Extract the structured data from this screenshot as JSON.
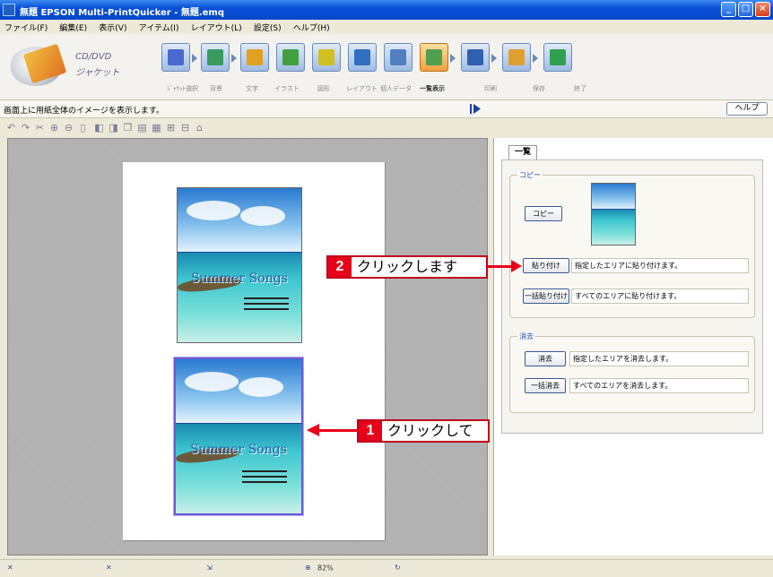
{
  "window": {
    "title": "無題 EPSON Multi-PrintQuicker - 無題.emq"
  },
  "menu": [
    "ファイル(F)",
    "編集(E)",
    "表示(V)",
    "アイテム(I)",
    "レイアウト(L)",
    "設定(S)",
    "ヘルプ(H)"
  ],
  "brand": {
    "line1": "CD/DVD",
    "line2": "ジャケット"
  },
  "toolbar": {
    "labels": [
      "ｼﾞｬｹｯﾄ選択",
      "背景",
      "文字",
      "イラスト",
      "図形",
      "レイアウト",
      "個人データ",
      "一覧表示",
      "印刷",
      "保存",
      "終了"
    ],
    "colors": {
      "tool_bg": "#9fbce4",
      "active_bg": "#f0a040"
    }
  },
  "infobar": {
    "message": "画面上に用紙全体のイメージを表示します。",
    "help_label": "ヘルプ"
  },
  "panel": {
    "tab_label": "一覧",
    "copy_group_title": "コピー",
    "copy_button": "コピー",
    "paste_button": "貼り付け",
    "paste_desc": "指定したエリアに貼り付けます。",
    "paste_all_button": "一括貼り付け",
    "paste_all_desc": "すべてのエリアに貼り付けます。",
    "erase_group_title": "消去",
    "erase_button": "消去",
    "erase_desc": "指定したエリアを消去します。",
    "erase_all_button": "一括消去",
    "erase_all_desc": "すべてのエリアを消去します。"
  },
  "jackets": [
    {
      "title": "Summer Songs"
    },
    {
      "title": "Summer Songs"
    }
  ],
  "callouts": {
    "step1": {
      "number": "1",
      "text": "クリックして"
    },
    "step2": {
      "number": "2",
      "text": "クリックします"
    },
    "color": "#e8001a"
  },
  "statusbar": {
    "zoom": "82%"
  }
}
